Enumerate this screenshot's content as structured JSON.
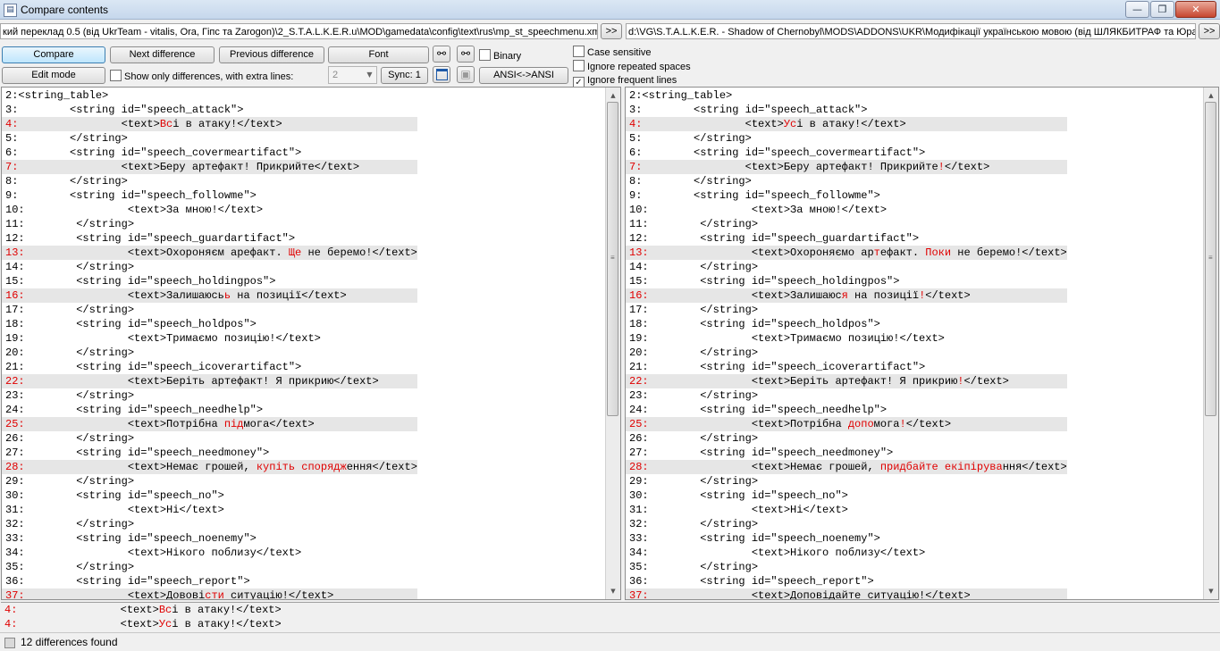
{
  "window": {
    "title": "Compare contents",
    "minimize": "—",
    "maximize": "❐",
    "close": "✕"
  },
  "paths": {
    "left": "кий переклад 0.5 (від UkrTeam - vitalis, Ora, Гіпс та Zarogon)\\2_S.T.A.L.K.E.R.u\\MOD\\gamedata\\config\\text\\rus\\mp_st_speechmenu.xml",
    "left_browse": ">>",
    "right": "d:\\VG\\S.T.A.L.K.E.R. - Shadow of Chernobyl\\MODS\\ADDONS\\UKR\\Модифікації українською мовою (від ШЛЯКБИТРАФ та Юра",
    "right_browse": ">>"
  },
  "toolbar": {
    "compare": "Compare",
    "next_diff": "Next difference",
    "prev_diff": "Previous difference",
    "font": "Font",
    "binary": "Binary",
    "edit_mode": "Edit mode",
    "show_only_diff": "Show only differences, with extra lines:",
    "extra_lines": "2",
    "sync": "Sync: 1",
    "ansi": "ANSI<->ANSI",
    "case_sensitive": "Case sensitive",
    "ignore_spaces": "Ignore repeated spaces",
    "ignore_frequent": "Ignore frequent lines",
    "icons": {
      "find": "binoculars-icon",
      "find_next": "binoculars-next-icon",
      "window": "window-icon",
      "save": "floppy-icon"
    }
  },
  "left_lines": [
    {
      "n": "2:",
      "s": [
        [
          "<string_table>",
          0
        ]
      ]
    },
    {
      "n": "3:",
      "s": [
        [
          "        <string id=\"speech_attack\">",
          0
        ]
      ]
    },
    {
      "n": "4:",
      "d": 1,
      "s": [
        [
          "                <text>",
          0
        ],
        [
          "Вс",
          1
        ],
        [
          "і в атаку!</text>",
          0
        ]
      ]
    },
    {
      "n": "5:",
      "s": [
        [
          "        </string>",
          0
        ]
      ]
    },
    {
      "n": "6:",
      "s": [
        [
          "        <string id=\"speech_covermeartifact\">",
          0
        ]
      ]
    },
    {
      "n": "7:",
      "d": 1,
      "s": [
        [
          "                <text>Беру артефакт! Прикрийте</text>",
          0
        ]
      ]
    },
    {
      "n": "8:",
      "s": [
        [
          "        </string>",
          0
        ]
      ]
    },
    {
      "n": "9:",
      "s": [
        [
          "        <string id=\"speech_followme\">",
          0
        ]
      ]
    },
    {
      "n": "10:",
      "s": [
        [
          "                <text>За мною!</text>",
          0
        ]
      ]
    },
    {
      "n": "11:",
      "s": [
        [
          "        </string>",
          0
        ]
      ]
    },
    {
      "n": "12:",
      "s": [
        [
          "        <string id=\"speech_guardartifact\">",
          0
        ]
      ]
    },
    {
      "n": "13:",
      "d": 1,
      "s": [
        [
          "                <text>Охороняєм арефакт. ",
          0
        ],
        [
          "Ще",
          1
        ],
        [
          " не беремо!</text>",
          0
        ]
      ]
    },
    {
      "n": "14:",
      "s": [
        [
          "        </string>",
          0
        ]
      ]
    },
    {
      "n": "15:",
      "s": [
        [
          "        <string id=\"speech_holdingpos\">",
          0
        ]
      ]
    },
    {
      "n": "16:",
      "d": 1,
      "s": [
        [
          "                <text>Залишаюсь",
          0
        ],
        [
          "ь",
          1
        ],
        [
          " на позиції</text>",
          0
        ]
      ]
    },
    {
      "n": "17:",
      "s": [
        [
          "        </string>",
          0
        ]
      ]
    },
    {
      "n": "18:",
      "s": [
        [
          "        <string id=\"speech_holdpos\">",
          0
        ]
      ]
    },
    {
      "n": "19:",
      "s": [
        [
          "                <text>Тримаємо позицію!</text>",
          0
        ]
      ]
    },
    {
      "n": "20:",
      "s": [
        [
          "        </string>",
          0
        ]
      ]
    },
    {
      "n": "21:",
      "s": [
        [
          "        <string id=\"speech_icoverartifact\">",
          0
        ]
      ]
    },
    {
      "n": "22:",
      "d": 1,
      "s": [
        [
          "                <text>Беріть артефакт! Я прикрию</text>",
          0
        ]
      ]
    },
    {
      "n": "23:",
      "s": [
        [
          "        </string>",
          0
        ]
      ]
    },
    {
      "n": "24:",
      "s": [
        [
          "        <string id=\"speech_needhelp\">",
          0
        ]
      ]
    },
    {
      "n": "25:",
      "d": 1,
      "s": [
        [
          "                <text>Потрібна ",
          0
        ],
        [
          "під",
          1
        ],
        [
          "мога</text>",
          0
        ]
      ]
    },
    {
      "n": "26:",
      "s": [
        [
          "        </string>",
          0
        ]
      ]
    },
    {
      "n": "27:",
      "s": [
        [
          "        <string id=\"speech_needmoney\">",
          0
        ]
      ]
    },
    {
      "n": "28:",
      "d": 1,
      "s": [
        [
          "                <text>Немає грошей, ",
          0
        ],
        [
          "купіть спорядж",
          1
        ],
        [
          "ення</text>",
          0
        ]
      ]
    },
    {
      "n": "29:",
      "s": [
        [
          "        </string>",
          0
        ]
      ]
    },
    {
      "n": "30:",
      "s": [
        [
          "        <string id=\"speech_no\">",
          0
        ]
      ]
    },
    {
      "n": "31:",
      "s": [
        [
          "                <text>Ні</text>",
          0
        ]
      ]
    },
    {
      "n": "32:",
      "s": [
        [
          "        </string>",
          0
        ]
      ]
    },
    {
      "n": "33:",
      "s": [
        [
          "        <string id=\"speech_noenemy\">",
          0
        ]
      ]
    },
    {
      "n": "34:",
      "s": [
        [
          "                <text>Нікого поблизу</text>",
          0
        ]
      ]
    },
    {
      "n": "35:",
      "s": [
        [
          "        </string>",
          0
        ]
      ]
    },
    {
      "n": "36:",
      "s": [
        [
          "        <string id=\"speech_report\">",
          0
        ]
      ]
    },
    {
      "n": "37:",
      "d": 1,
      "s": [
        [
          "                <text>Довові",
          0
        ],
        [
          "сти",
          1
        ],
        [
          " ситуацію!</text>",
          0
        ]
      ]
    }
  ],
  "right_lines": [
    {
      "n": "2:",
      "s": [
        [
          "<string_table>",
          0
        ]
      ]
    },
    {
      "n": "3:",
      "s": [
        [
          "        <string id=\"speech_attack\">",
          0
        ]
      ]
    },
    {
      "n": "4:",
      "d": 1,
      "s": [
        [
          "                <text>",
          0
        ],
        [
          "Ус",
          1
        ],
        [
          "і в атаку!</text>",
          0
        ]
      ]
    },
    {
      "n": "5:",
      "s": [
        [
          "        </string>",
          0
        ]
      ]
    },
    {
      "n": "6:",
      "s": [
        [
          "        <string id=\"speech_covermeartifact\">",
          0
        ]
      ]
    },
    {
      "n": "7:",
      "d": 1,
      "s": [
        [
          "                <text>Беру артефакт! Прикрийте",
          0
        ],
        [
          "!",
          1
        ],
        [
          "</text>",
          0
        ]
      ]
    },
    {
      "n": "8:",
      "s": [
        [
          "        </string>",
          0
        ]
      ]
    },
    {
      "n": "9:",
      "s": [
        [
          "        <string id=\"speech_followme\">",
          0
        ]
      ]
    },
    {
      "n": "10:",
      "s": [
        [
          "                <text>За мною!</text>",
          0
        ]
      ]
    },
    {
      "n": "11:",
      "s": [
        [
          "        </string>",
          0
        ]
      ]
    },
    {
      "n": "12:",
      "s": [
        [
          "        <string id=\"speech_guardartifact\">",
          0
        ]
      ]
    },
    {
      "n": "13:",
      "d": 1,
      "s": [
        [
          "                <text>Охороняємо ар",
          0
        ],
        [
          "т",
          1
        ],
        [
          "ефакт. ",
          0
        ],
        [
          "Поки",
          1
        ],
        [
          " не беремо!</text>",
          0
        ]
      ]
    },
    {
      "n": "14:",
      "s": [
        [
          "        </string>",
          0
        ]
      ]
    },
    {
      "n": "15:",
      "s": [
        [
          "        <string id=\"speech_holdingpos\">",
          0
        ]
      ]
    },
    {
      "n": "16:",
      "d": 1,
      "s": [
        [
          "                <text>Залишаюс",
          0
        ],
        [
          "я",
          1
        ],
        [
          " на позиції",
          0
        ],
        [
          "!",
          1
        ],
        [
          "</text>",
          0
        ]
      ]
    },
    {
      "n": "17:",
      "s": [
        [
          "        </string>",
          0
        ]
      ]
    },
    {
      "n": "18:",
      "s": [
        [
          "        <string id=\"speech_holdpos\">",
          0
        ]
      ]
    },
    {
      "n": "19:",
      "s": [
        [
          "                <text>Тримаємо позицію!</text>",
          0
        ]
      ]
    },
    {
      "n": "20:",
      "s": [
        [
          "        </string>",
          0
        ]
      ]
    },
    {
      "n": "21:",
      "s": [
        [
          "        <string id=\"speech_icoverartifact\">",
          0
        ]
      ]
    },
    {
      "n": "22:",
      "d": 1,
      "s": [
        [
          "                <text>Беріть артефакт! Я прикрию",
          0
        ],
        [
          "!",
          1
        ],
        [
          "</text>",
          0
        ]
      ]
    },
    {
      "n": "23:",
      "s": [
        [
          "        </string>",
          0
        ]
      ]
    },
    {
      "n": "24:",
      "s": [
        [
          "        <string id=\"speech_needhelp\">",
          0
        ]
      ]
    },
    {
      "n": "25:",
      "d": 1,
      "s": [
        [
          "                <text>Потрібна ",
          0
        ],
        [
          "допо",
          1
        ],
        [
          "мога",
          0
        ],
        [
          "!",
          1
        ],
        [
          "</text>",
          0
        ]
      ]
    },
    {
      "n": "26:",
      "s": [
        [
          "        </string>",
          0
        ]
      ]
    },
    {
      "n": "27:",
      "s": [
        [
          "        <string id=\"speech_needmoney\">",
          0
        ]
      ]
    },
    {
      "n": "28:",
      "d": 1,
      "s": [
        [
          "                <text>Немає грошей, ",
          0
        ],
        [
          "придбайте екіпірува",
          1
        ],
        [
          "ння</text>",
          0
        ]
      ]
    },
    {
      "n": "29:",
      "s": [
        [
          "        </string>",
          0
        ]
      ]
    },
    {
      "n": "30:",
      "s": [
        [
          "        <string id=\"speech_no\">",
          0
        ]
      ]
    },
    {
      "n": "31:",
      "s": [
        [
          "                <text>Ні</text>",
          0
        ]
      ]
    },
    {
      "n": "32:",
      "s": [
        [
          "        </string>",
          0
        ]
      ]
    },
    {
      "n": "33:",
      "s": [
        [
          "        <string id=\"speech_noenemy\">",
          0
        ]
      ]
    },
    {
      "n": "34:",
      "s": [
        [
          "                <text>Нікого поблизу</text>",
          0
        ]
      ]
    },
    {
      "n": "35:",
      "s": [
        [
          "        </string>",
          0
        ]
      ]
    },
    {
      "n": "36:",
      "s": [
        [
          "        <string id=\"speech_report\">",
          0
        ]
      ]
    },
    {
      "n": "37:",
      "d": 1,
      "s": [
        [
          "                <text>Доповідайте ситуацію!</text>",
          0
        ]
      ]
    }
  ],
  "bottom_lines": [
    {
      "n": "4:",
      "s": [
        [
          "                <text>",
          0
        ],
        [
          "Вс",
          1
        ],
        [
          "і в атаку!</text>",
          0
        ]
      ]
    },
    {
      "n": "4:",
      "s": [
        [
          "                <text>",
          0
        ],
        [
          "Ус",
          1
        ],
        [
          "і в атаку!</text>",
          0
        ]
      ]
    }
  ],
  "status": {
    "text": "12 differences found"
  },
  "colors": {
    "diff_text": "#e00000",
    "diff_row": "#e6e6e6"
  }
}
